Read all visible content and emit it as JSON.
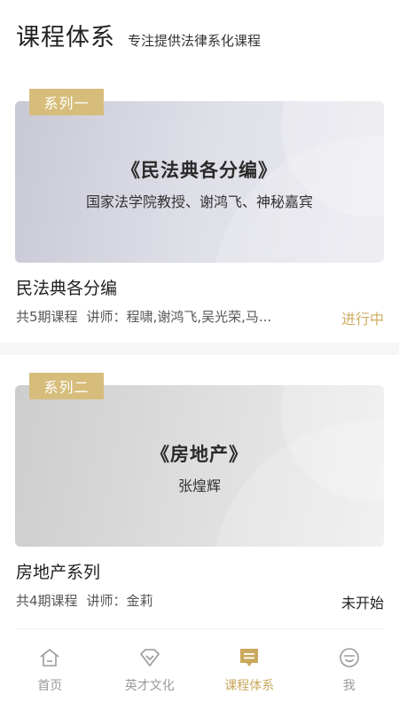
{
  "header": {
    "title": "课程体系",
    "subtitle": "专注提供法律系化课程"
  },
  "courses": [
    {
      "tag": "系列一",
      "banner_title": "《民法典各分编》",
      "banner_subtitle": "国家法学院教授、谢鸿飞、神秘嘉宾",
      "name": "民法典各分编",
      "periods": "共5期课程",
      "teachers": "讲师：程啸,谢鸿飞,吴光荣,马...",
      "status": "进行中"
    },
    {
      "tag": "系列二",
      "banner_title": "《房地产》",
      "banner_subtitle": "张煌辉",
      "name": "房地产系列",
      "periods": "共4期课程",
      "teachers": "讲师：金莉",
      "status": "未开始"
    }
  ],
  "tabbar": {
    "items": [
      {
        "label": "首页",
        "icon": "home-icon"
      },
      {
        "label": "英才文化",
        "icon": "diamond-icon"
      },
      {
        "label": "课程体系",
        "icon": "message-icon",
        "active": true
      },
      {
        "label": "我",
        "icon": "smiley-icon"
      }
    ]
  },
  "colors": {
    "accent": "#d7bd7b",
    "status_ongoing": "#cfae63",
    "tab_active": "#caa85d",
    "tab_inactive": "#9a9a9a"
  }
}
